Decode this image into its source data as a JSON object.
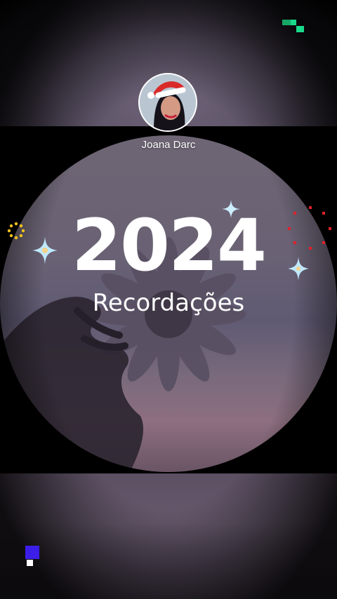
{
  "profile": {
    "name": "Joana Darc"
  },
  "memories": {
    "year": "2024",
    "subtitle": "Recordações"
  },
  "colors": {
    "accent_green": "#19d98b",
    "accent_blue": "#3b1ee8",
    "sparkle_blue": "#bfe8ff",
    "dot_red": "#e0202a",
    "dot_yellow": "#f2c21a"
  }
}
